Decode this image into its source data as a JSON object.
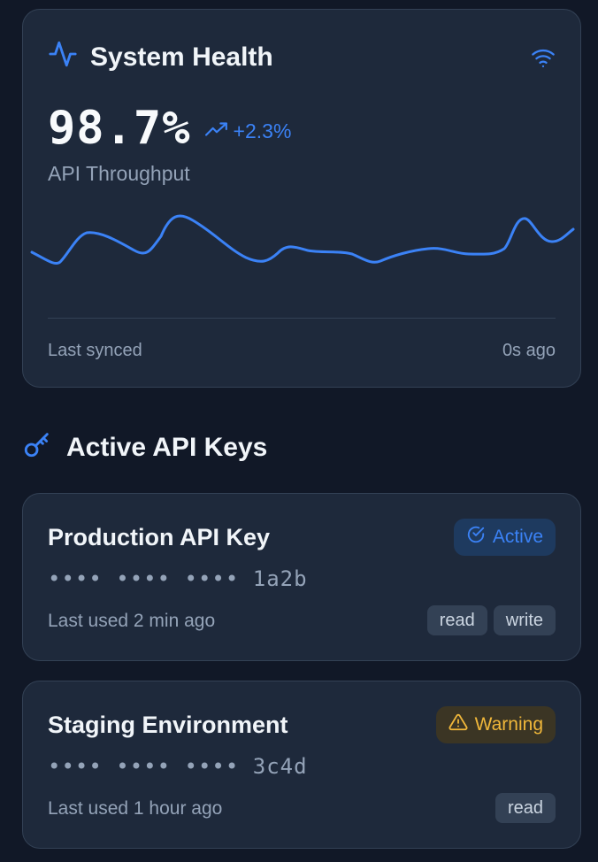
{
  "health": {
    "title": "System Health",
    "icon": "activity-icon",
    "status_icon": "wifi-icon",
    "metric_value": "98.7%",
    "trend_icon": "trending-up-icon",
    "trend_value": "+2.3%",
    "metric_label": "API Throughput",
    "sync_label": "Last synced",
    "sync_value": "0s ago"
  },
  "keys_section": {
    "title": "Active API Keys",
    "icon": "key-icon"
  },
  "keys": [
    {
      "name": "Production API Key",
      "status": "Active",
      "status_icon": "check-circle-icon",
      "masked": "•••• •••• •••• 1a2b",
      "last_used": "Last used 2 min ago",
      "scopes": [
        "read",
        "write"
      ]
    },
    {
      "name": "Staging Environment",
      "status": "Warning",
      "status_icon": "warning-icon",
      "masked": "•••• •••• •••• 3c4d",
      "last_used": "Last used 1 hour ago",
      "scopes": [
        "read"
      ]
    }
  ],
  "colors": {
    "accent": "#3b82f6",
    "warning": "#f0b73a",
    "background": "#111827",
    "card": "#1e293b"
  }
}
